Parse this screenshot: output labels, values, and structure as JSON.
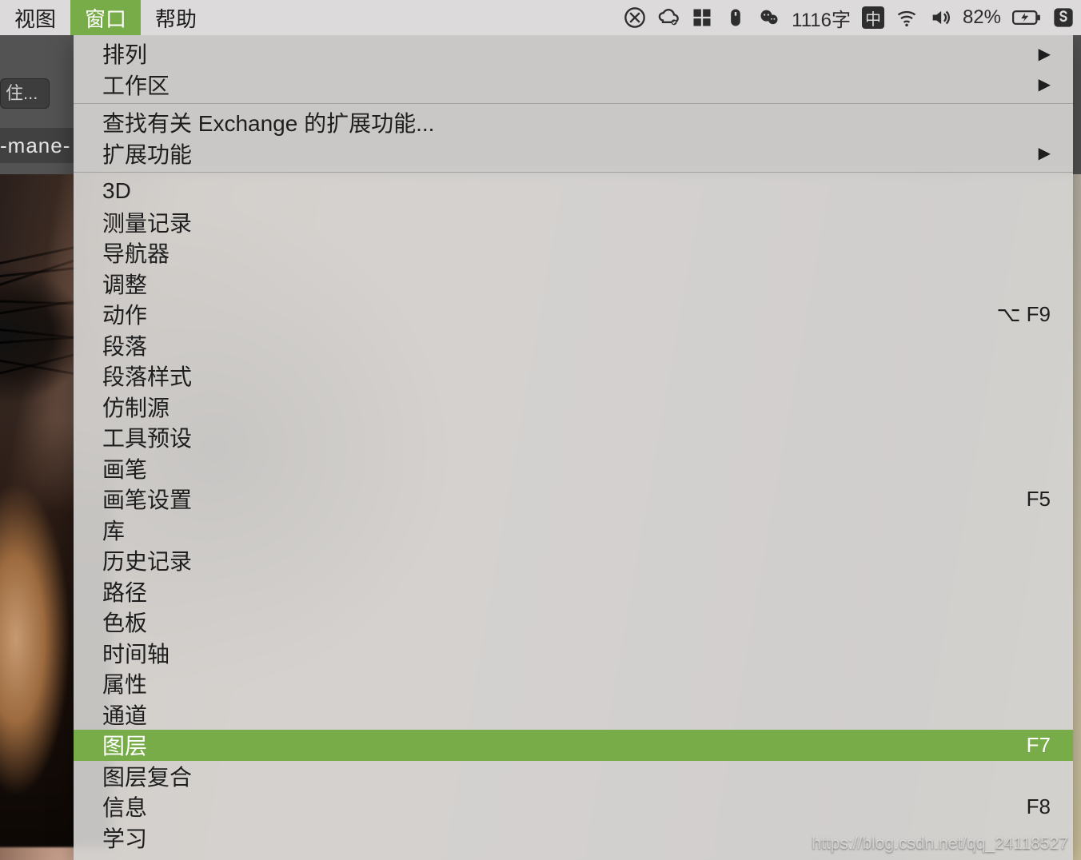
{
  "menubar": {
    "items": [
      {
        "label": "视图"
      },
      {
        "label": "窗口"
      },
      {
        "label": "帮助"
      }
    ],
    "active_index": 1,
    "status": {
      "word_count": "1116字",
      "input_method": "中",
      "battery_percent": "82%"
    }
  },
  "toolbar": {
    "field_fragment": "住..."
  },
  "document_tab_fragment": "-mane-",
  "menu": {
    "sections": [
      [
        {
          "label": "排列",
          "submenu": true
        },
        {
          "label": "工作区",
          "submenu": true
        }
      ],
      [
        {
          "label": "查找有关 Exchange 的扩展功能..."
        },
        {
          "label": "扩展功能",
          "submenu": true
        }
      ],
      [
        {
          "label": "3D"
        },
        {
          "label": "测量记录"
        },
        {
          "label": "导航器"
        },
        {
          "label": "调整"
        },
        {
          "label": "动作",
          "shortcut": "⌥ F9"
        },
        {
          "label": "段落"
        },
        {
          "label": "段落样式"
        },
        {
          "label": "仿制源"
        },
        {
          "label": "工具预设"
        },
        {
          "label": "画笔"
        },
        {
          "label": "画笔设置",
          "shortcut": "F5"
        },
        {
          "label": "库"
        },
        {
          "label": "历史记录"
        },
        {
          "label": "路径"
        },
        {
          "label": "色板"
        },
        {
          "label": "时间轴"
        },
        {
          "label": "属性"
        },
        {
          "label": "通道"
        },
        {
          "label": "图层",
          "shortcut": "F7",
          "selected": true
        },
        {
          "label": "图层复合"
        },
        {
          "label": "信息",
          "shortcut": "F8"
        },
        {
          "label": "学习"
        }
      ]
    ]
  },
  "watermark": "https://blog.csdn.net/qq_24118527"
}
